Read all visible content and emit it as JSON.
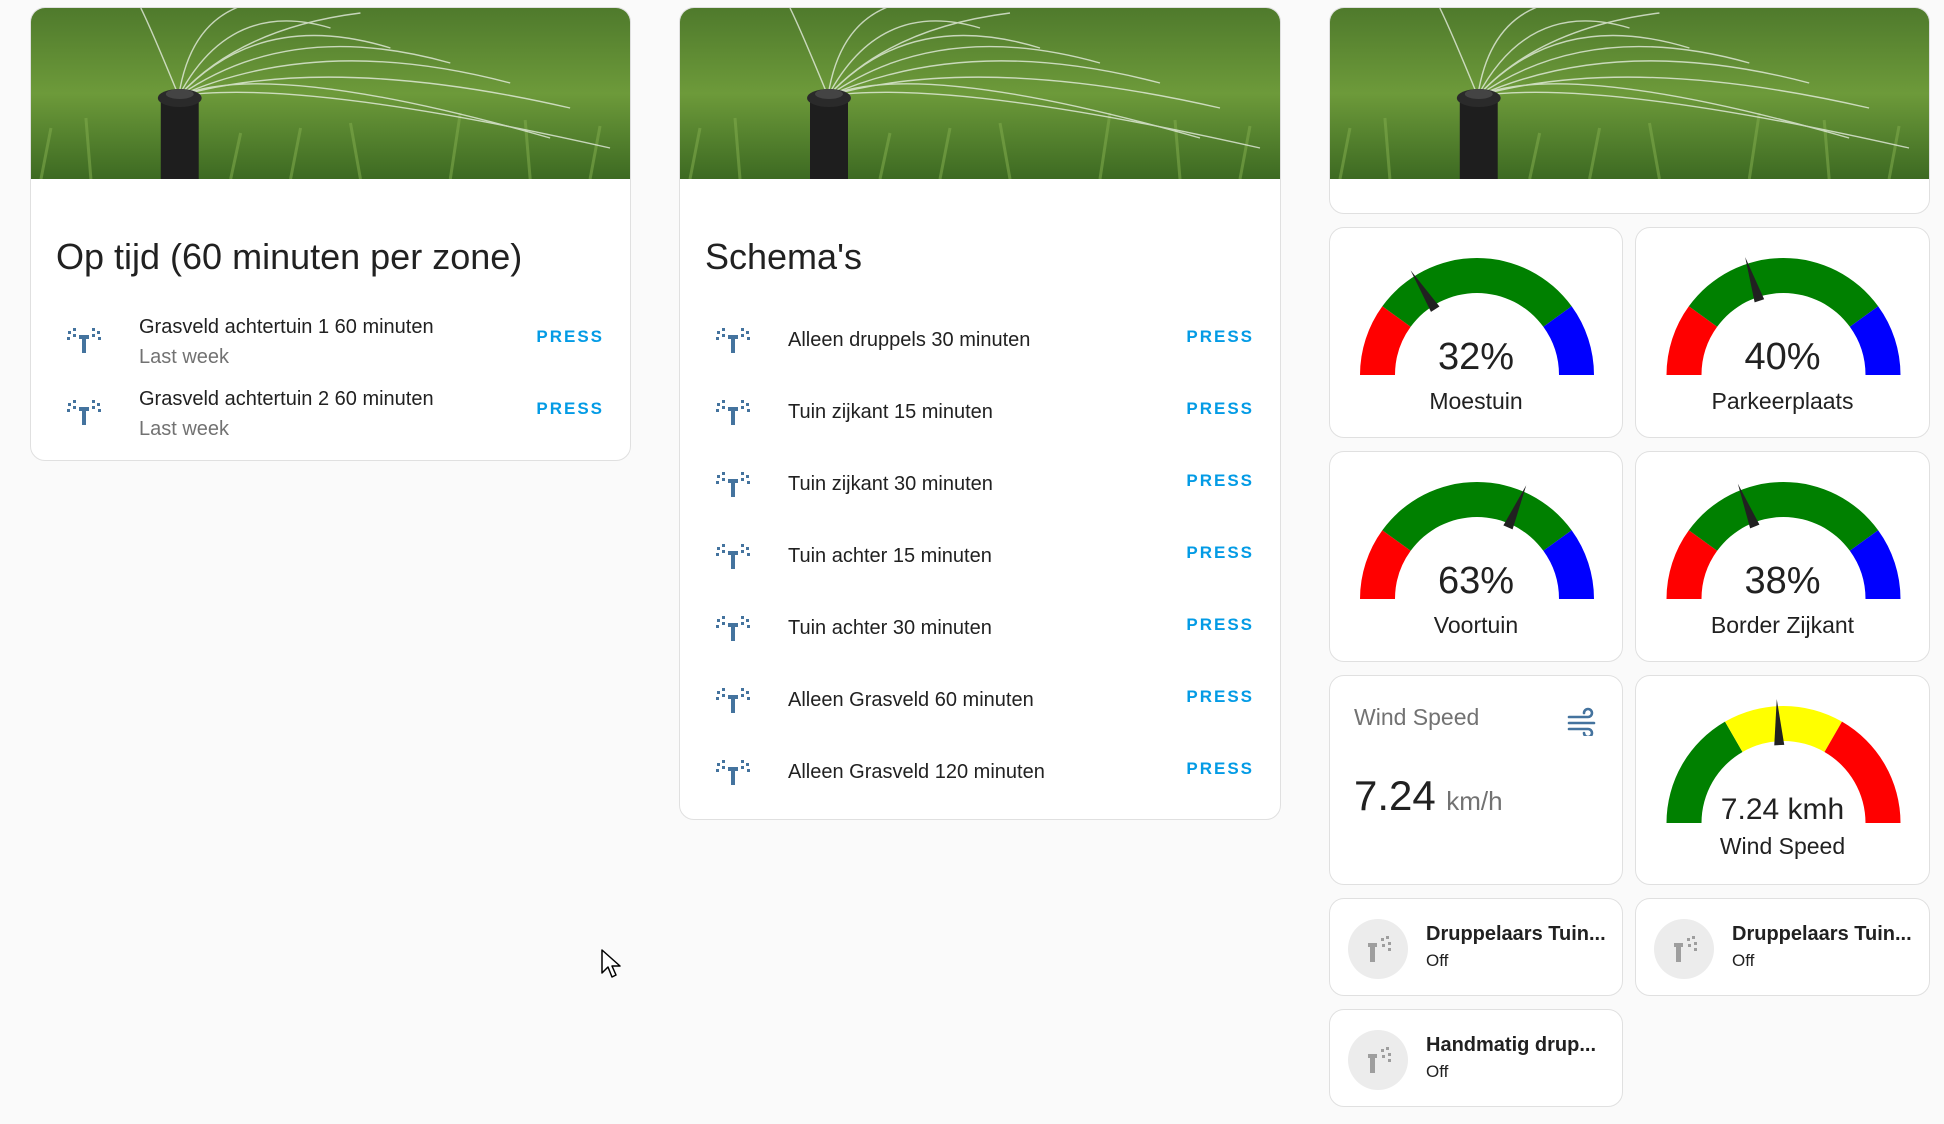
{
  "cards": {
    "op_tijd": {
      "title": "Op tijd (60 minuten per zone)",
      "rows": [
        {
          "name": "Grasveld achtertuin 1 60 minuten",
          "sub": "Last week",
          "action": "PRESS"
        },
        {
          "name": "Grasveld achtertuin 2 60 minuten",
          "sub": "Last week",
          "action": "PRESS"
        }
      ]
    },
    "schemas": {
      "title": "Schema's",
      "rows": [
        {
          "name": "Alleen druppels 30 minuten",
          "action": "PRESS"
        },
        {
          "name": "Tuin zijkant 15 minuten",
          "action": "PRESS"
        },
        {
          "name": "Tuin zijkant 30 minuten",
          "action": "PRESS"
        },
        {
          "name": "Tuin achter 15 minuten",
          "action": "PRESS"
        },
        {
          "name": "Tuin achter 30 minuten",
          "action": "PRESS"
        },
        {
          "name": "Alleen Grasveld 60 minuten",
          "action": "PRESS"
        },
        {
          "name": "Alleen Grasveld 120 minuten",
          "action": "PRESS"
        }
      ]
    },
    "gauges": [
      {
        "value_text": "32%",
        "value": 32,
        "label": "Moestuin"
      },
      {
        "value_text": "40%",
        "value": 40,
        "label": "Parkeerplaats"
      },
      {
        "value_text": "63%",
        "value": 63,
        "label": "Voortuin"
      },
      {
        "value_text": "38%",
        "value": 38,
        "label": "Border Zijkant"
      }
    ],
    "wind_sensor": {
      "title": "Wind Speed",
      "value": "7.24",
      "unit": "km/h",
      "icon": "weather-windy-icon"
    },
    "wind_gauge": {
      "value_text": "7.24 kmh",
      "value": 7.24,
      "label": "Wind Speed"
    },
    "tiles": [
      {
        "name": "Druppelaars Tuin...",
        "state": "Off",
        "icon": "sprinkler-icon"
      },
      {
        "name": "Druppelaars Tuin...",
        "state": "Off",
        "icon": "sprinkler-icon"
      },
      {
        "name": "Handmatig drup...",
        "state": "Off",
        "icon": "sprinkler-icon"
      }
    ]
  },
  "colors": {
    "accent": "#039be5",
    "gauge_red": "#ff0000",
    "gauge_green": "#008000",
    "gauge_blue": "#0000ff",
    "gauge_yellow": "#ffff00",
    "icon_blue": "#44739e"
  }
}
